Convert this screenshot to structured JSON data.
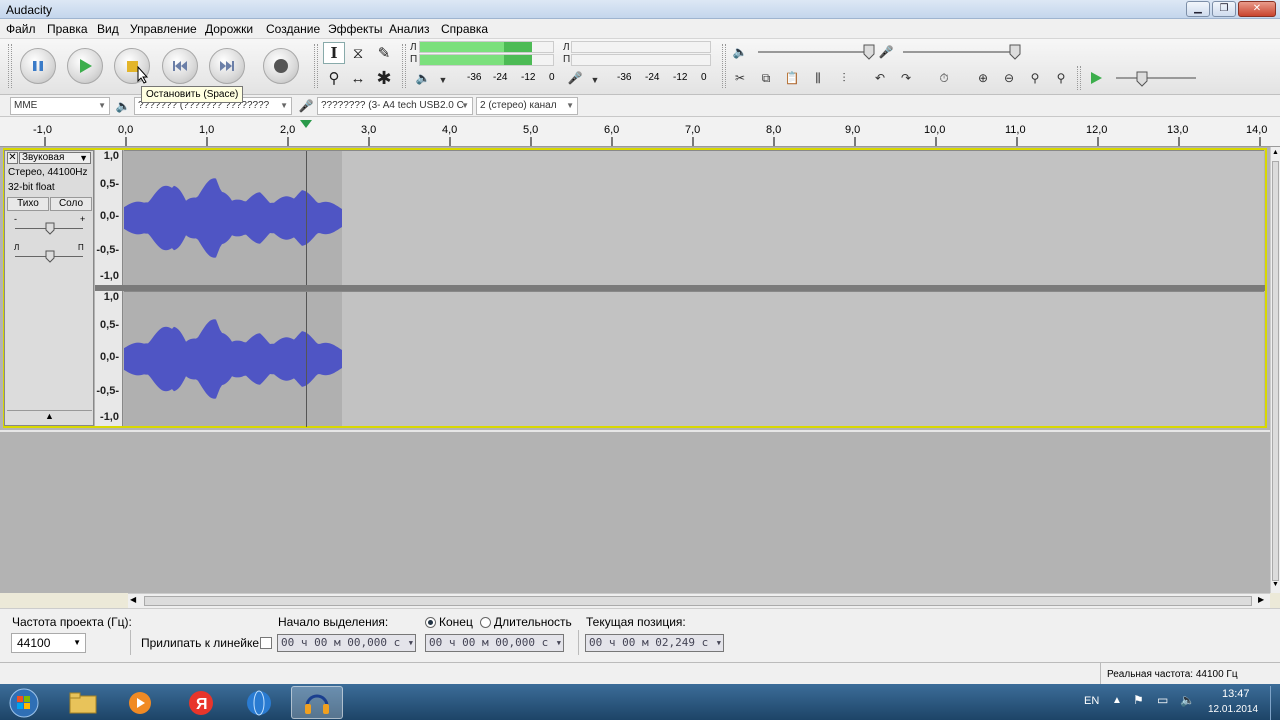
{
  "window": {
    "title": "Audacity"
  },
  "menu": [
    "Файл",
    "Правка",
    "Вид",
    "Управление",
    "Дорожки",
    "Создание",
    "Эффекты",
    "Анализ",
    "Справка"
  ],
  "meters": {
    "left_label": "Л",
    "right_label": "П",
    "scale_play": [
      "-36",
      "-24",
      "-12",
      "0"
    ],
    "scale_rec": [
      "-36",
      "-24",
      "-12",
      "0"
    ]
  },
  "tooltip": "Остановить (Space)",
  "device": {
    "host": "MME",
    "output": "??????? (??????? ????????",
    "input": "???????? (3- A4 tech USB2.0 C",
    "channels": "2 (стерео) канал"
  },
  "ruler": {
    "ticks": [
      "-1,0",
      "0,0",
      "1,0",
      "2,0",
      "3,0",
      "4,0",
      "5,0",
      "6,0",
      "7,0",
      "8,0",
      "9,0",
      "10,0",
      "11,0",
      "12,0",
      "13,0",
      "14,0"
    ]
  },
  "track": {
    "name": "Звуковая",
    "info1": "Стерео, 44100Hz",
    "info2": "32-bit float",
    "mute": "Тихо",
    "solo": "Соло",
    "gain_minus": "-",
    "gain_plus": "+",
    "pan_left": "Л",
    "pan_right": "П",
    "scale": [
      "1,0",
      "0,5-",
      "0,0-",
      "-0,5-",
      "-1,0"
    ]
  },
  "bottom": {
    "project_rate_label": "Частота проекта (Гц):",
    "project_rate": "44100",
    "snap_label": "Прилипать к линейке",
    "sel_start_label": "Начало выделения:",
    "end_label": "Конец",
    "length_label": "Длительность",
    "position_label": "Текущая позиция:",
    "sel_start": "00 ч 00 м 00,000 с",
    "sel_end": "00 ч 00 м 00,000 с",
    "position": "00 ч 00 м 02,249 с"
  },
  "status": {
    "actual_rate": "Реальная частота: 44100 Гц"
  },
  "taskbar": {
    "lang": "EN",
    "time": "13:47",
    "date": "12.01.2014"
  },
  "colors": {
    "waveform": "#4f55c4",
    "meter_green": "#59d35b",
    "playhead": "#2a9a4a"
  }
}
